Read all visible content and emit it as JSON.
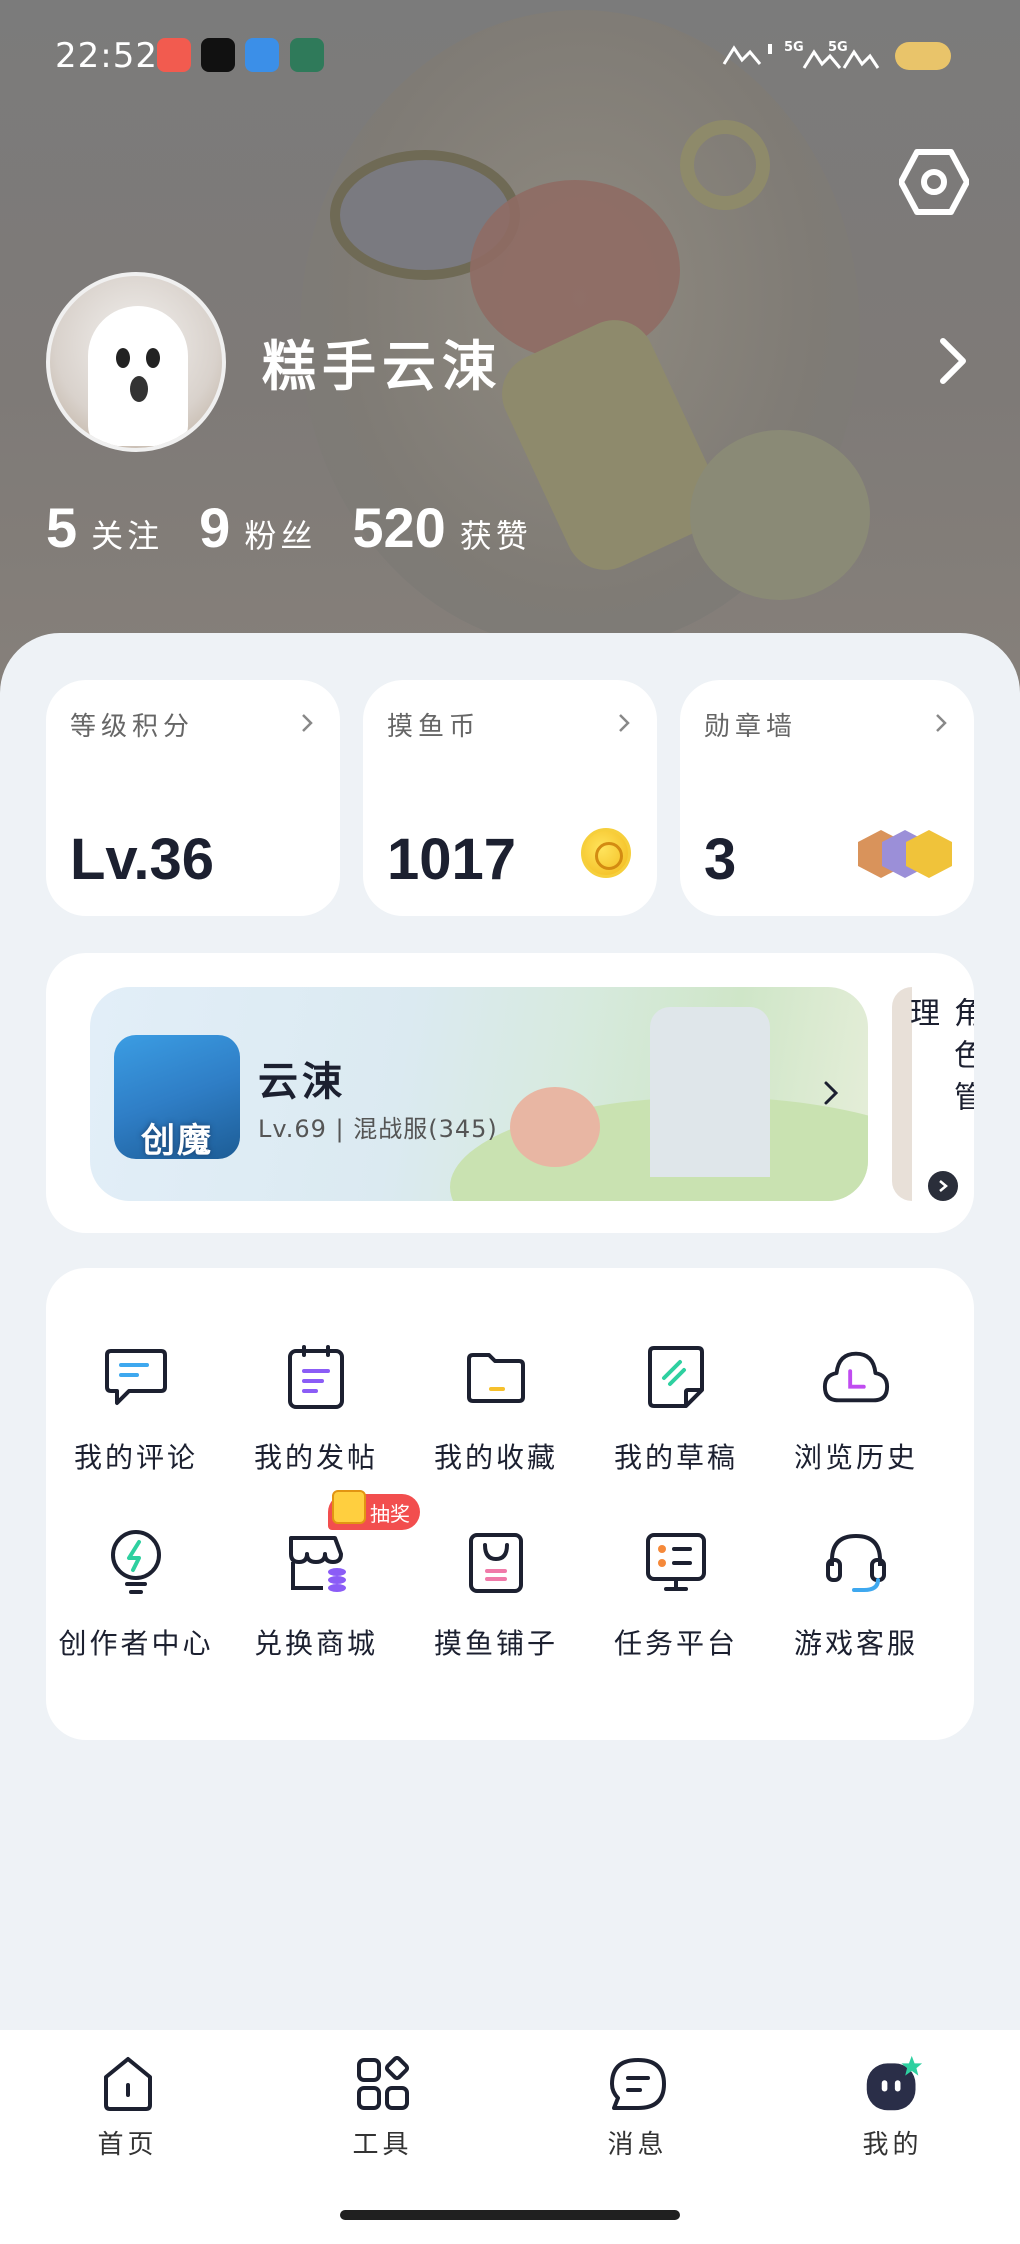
{
  "status_bar": {
    "time": "22:52",
    "network_1": "5G",
    "network_2": "5G"
  },
  "profile": {
    "username": "糕手云涑",
    "stats": [
      {
        "value": "5",
        "label": "关注"
      },
      {
        "value": "9",
        "label": "粉丝"
      },
      {
        "value": "520",
        "label": "获赞"
      }
    ]
  },
  "cards": [
    {
      "title": "等级积分",
      "value": "Lv.36"
    },
    {
      "title": "摸鱼币",
      "value": "1017"
    },
    {
      "title": "勋章墙",
      "value": "3"
    }
  ],
  "game": {
    "icon_text": "创魔",
    "name": "云涑",
    "meta": "Lv.69 | 混战服(345)",
    "role_manage": "角色管理"
  },
  "functions": [
    {
      "label": "我的评论",
      "icon": "comment-icon"
    },
    {
      "label": "我的发帖",
      "icon": "post-icon"
    },
    {
      "label": "我的收藏",
      "icon": "folder-icon"
    },
    {
      "label": "我的草稿",
      "icon": "draft-icon"
    },
    {
      "label": "浏览历史",
      "icon": "history-icon"
    },
    {
      "label": "创作者中心",
      "icon": "bulb-icon"
    },
    {
      "label": "兑换商城",
      "icon": "shop-icon",
      "tag": "抽奖"
    },
    {
      "label": "摸鱼铺子",
      "icon": "bag-icon"
    },
    {
      "label": "任务平台",
      "icon": "task-icon"
    },
    {
      "label": "游戏客服",
      "icon": "headset-icon"
    }
  ],
  "nav": [
    {
      "label": "首页",
      "icon": "home-icon"
    },
    {
      "label": "工具",
      "icon": "tools-icon"
    },
    {
      "label": "消息",
      "icon": "message-icon"
    },
    {
      "label": "我的",
      "icon": "profile-icon",
      "active": true
    }
  ],
  "colors": {
    "text_dark": "#1c2030",
    "accent_purple": "#8b5cf6",
    "accent_blue": "#3ea8ef",
    "accent_yellow": "#f6c02c",
    "accent_green": "#2ed0a0",
    "tag_red": "#f24e4e"
  }
}
